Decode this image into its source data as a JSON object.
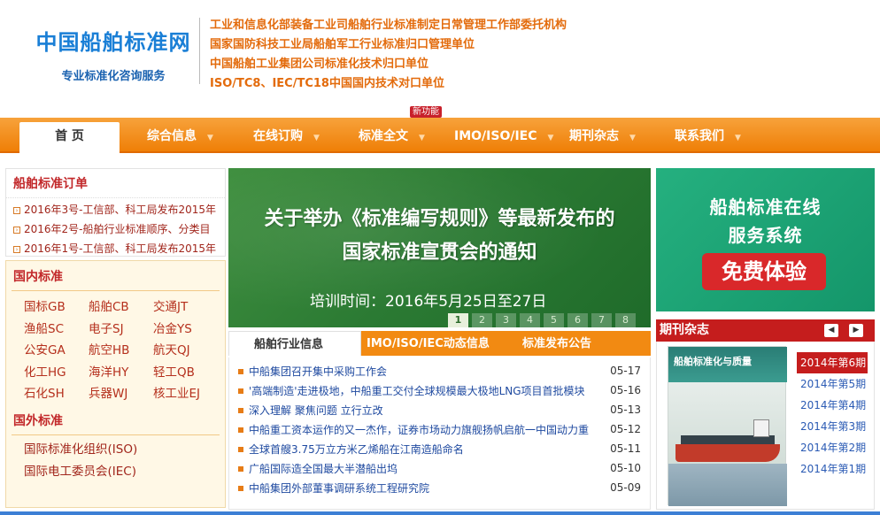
{
  "header": {
    "logo_title": "中国船舶标准网",
    "logo_sub": "专业标准化咨询服务",
    "orgs": [
      "工业和信息化部装备工业司船舶行业标准制定日常管理工作部委托机构",
      "国家国防科技工业局船舶军工行业标准归口管理单位",
      "中国船舶工业集团公司标准化技术归口单位",
      "ISO/TC8、IEC/TC18中国国内技术对口单位"
    ]
  },
  "nav": {
    "home": "首 页",
    "items": [
      "综合信息",
      "在线订购",
      "标准全文",
      "IMO/ISO/IEC",
      "期刊杂志",
      "联系我们"
    ],
    "new_badge": "新功能"
  },
  "orders": {
    "title": "船舶标准订单",
    "items": [
      "2016年3号-工信部、科工局发布2015年",
      "2016年2号-船舶行业标准顺序、分类目",
      "2016年1号-工信部、科工局发布2015年"
    ]
  },
  "domestic": {
    "title": "国内标准",
    "items": [
      "国标GB",
      "船舶CB",
      "交通JT",
      "渔船SC",
      "电子SJ",
      "冶金YS",
      "公安GA",
      "航空HB",
      "航天QJ",
      "化工HG",
      "海洋HY",
      "轻工QB",
      "石化SH",
      "兵器WJ",
      "核工业EJ"
    ]
  },
  "foreign": {
    "title": "国外标准",
    "items": [
      "国际标准化组织(ISO)",
      "国际电工委员会(IEC)"
    ]
  },
  "banner": {
    "title_line1": "关于举办《标准编写规则》等最新发布的",
    "title_line2": "国家标准宣贯会的通知",
    "time": "培训时间：2016年5月25日至27日",
    "pages": [
      "1",
      "2",
      "3",
      "4",
      "5",
      "6",
      "7",
      "8"
    ]
  },
  "tabs": [
    "船舶行业信息",
    "IMO/ISO/IEC动态信息",
    "标准发布公告"
  ],
  "news": [
    {
      "title": "中船集团召开集中采购工作会",
      "date": "05-17"
    },
    {
      "title": "'高端制造'走进极地，中船重工交付全球规模最大极地LNG项目首批模块",
      "date": "05-16"
    },
    {
      "title": "深入理解 聚焦问题 立行立改",
      "date": "05-13"
    },
    {
      "title": "中船重工资本运作的又一杰作，证券市场动力旗舰扬帆启航一中国动力重",
      "date": "05-12"
    },
    {
      "title": "全球首艘3.75万立方米乙烯船在江南造船命名",
      "date": "05-11"
    },
    {
      "title": "广船国际造全国最大半潜船出坞",
      "date": "05-10"
    },
    {
      "title": "中船集团外部董事调研系统工程研究院",
      "date": "05-09"
    }
  ],
  "service": {
    "line1": "船舶标准在线",
    "line2": "服务系统",
    "cta": "免费体验"
  },
  "journal": {
    "title": "期刊杂志",
    "prev": "◀",
    "next": "▶",
    "cover_title": "船舶标准化与质量",
    "issues": [
      "2014年第6期",
      "2014年第5期",
      "2014年第4期",
      "2014年第3期",
      "2014年第2期",
      "2014年第1期"
    ]
  },
  "colors": {
    "nav_orange": "#ef7f07",
    "accent_red": "#c51d1d",
    "banner_green": "#2b7a33",
    "service_green": "#14966a"
  }
}
